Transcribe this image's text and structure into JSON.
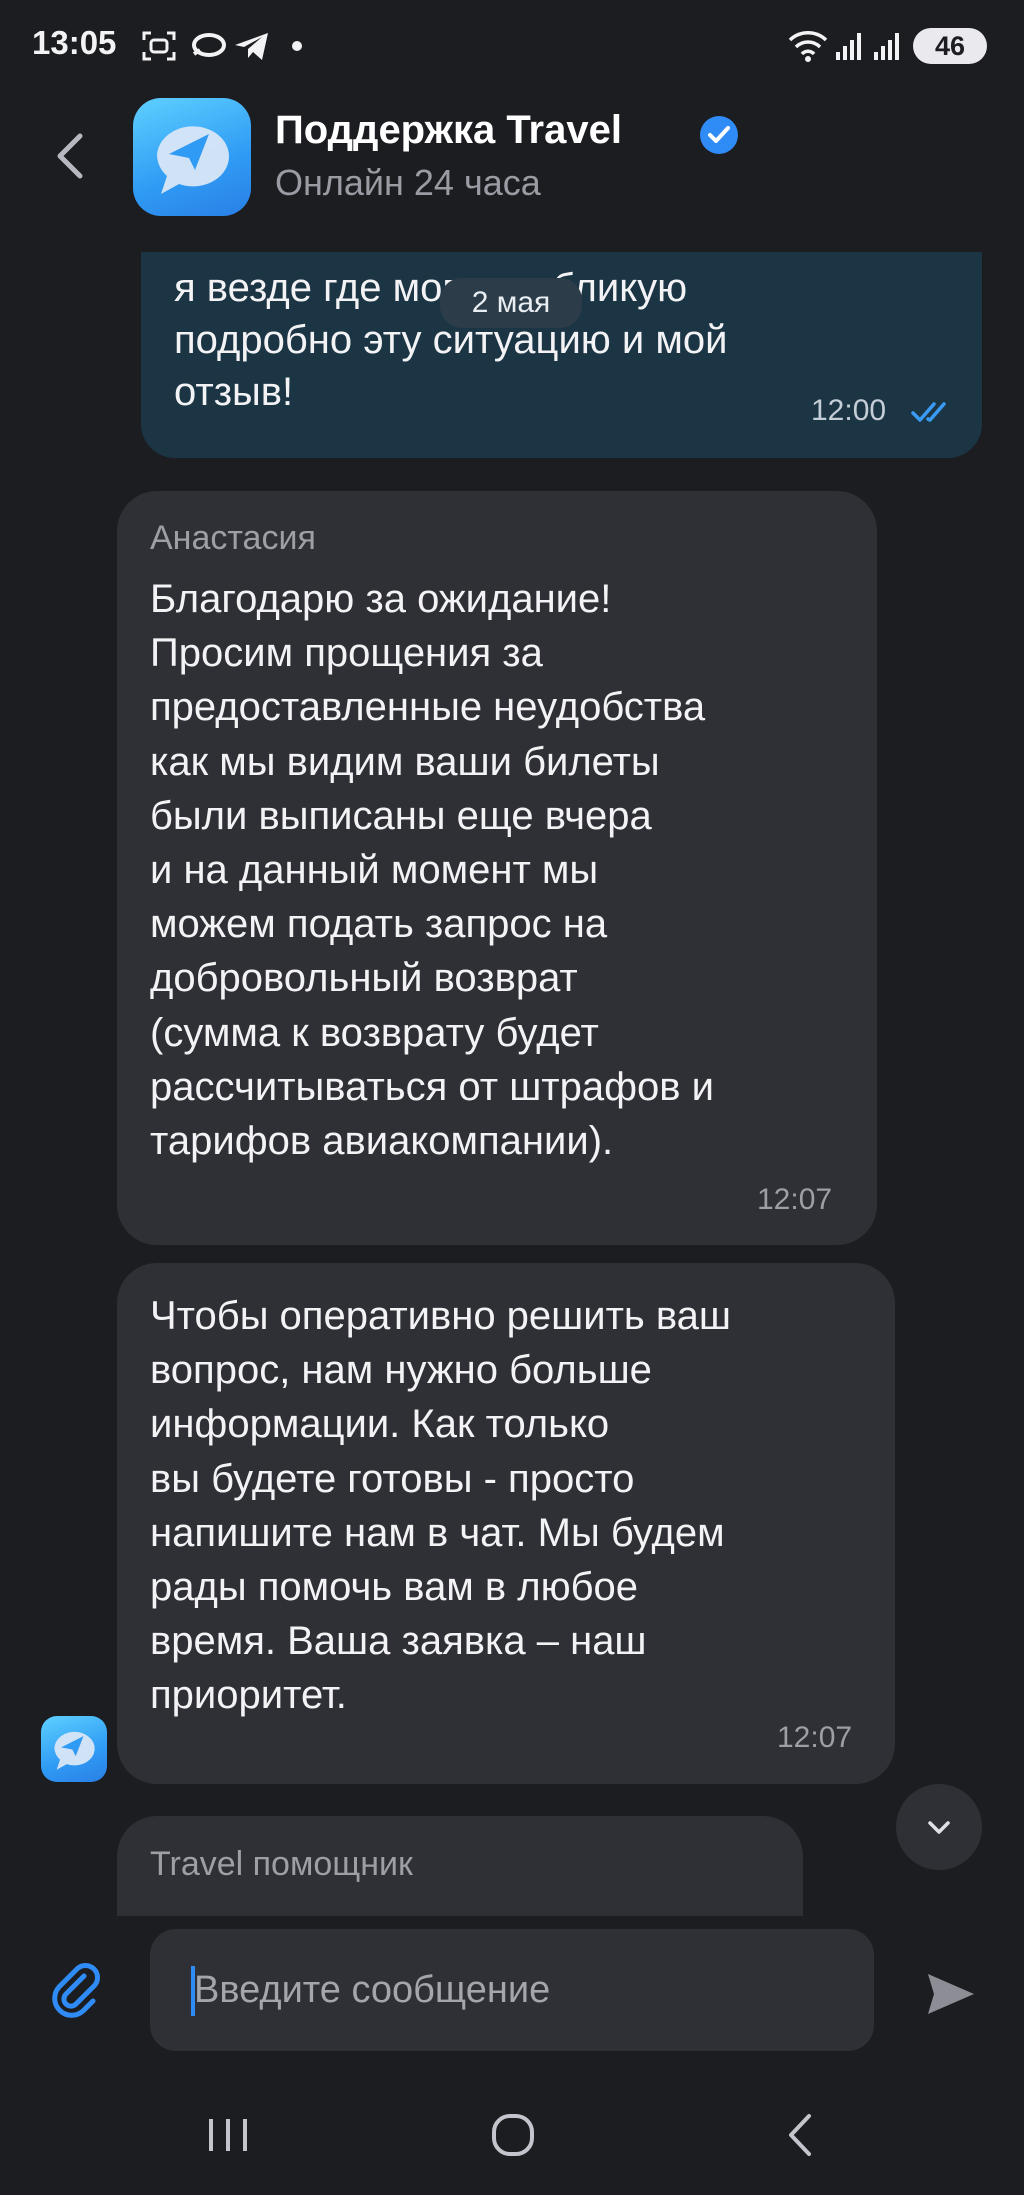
{
  "status_bar": {
    "time": "13:05",
    "battery": "46",
    "icons": [
      "screenshot-icon",
      "chat-bubble-icon",
      "telegram-icon",
      "dot-icon",
      "wifi-icon",
      "signal-icon",
      "signal-icon",
      "battery-icon"
    ]
  },
  "header": {
    "title": "Поддержка Travel",
    "status": "Онлайн 24 часа",
    "verified": true
  },
  "date_chip": "2 мая",
  "messages": [
    {
      "direction": "outgoing",
      "text": "я везде где могу опубликую\nподробно эту ситуацию и мой\nотзыв!",
      "time": "12:00",
      "read": true
    },
    {
      "direction": "incoming",
      "sender": "Анастасия",
      "text": "Благодарю за ожидание!\nПросим прощения за\nпредоставленные неудобства\nкак мы видим ваши билеты\nбыли выписаны еще вчера\nи на данный момент мы\nможем подать запрос на\nдобровольный возврат\n(сумма к возврату будет\nрассчитываться от штрафов и\nтарифов авиакомпании).",
      "time": "12:07"
    },
    {
      "direction": "incoming",
      "text": "Чтобы оперативно решить ваш\nвопрос, нам нужно больше\nинформации. Как только\nвы будете готовы - просто\nнапишите нам в чат. Мы будем\nрады помочь вам в любое\nвремя. Ваша заявка – наш\nприоритет.",
      "time": "12:07"
    },
    {
      "direction": "incoming",
      "sender": "Travel помощник",
      "text": "",
      "time": ""
    }
  ],
  "composer": {
    "placeholder": "Введите сообщение"
  },
  "colors": {
    "background": "#1c1d21",
    "incoming_bubble": "#2f3035",
    "outgoing_bubble": "#1b3545",
    "accent": "#2f8cf6",
    "secondary_text": "#9d9ea6"
  }
}
